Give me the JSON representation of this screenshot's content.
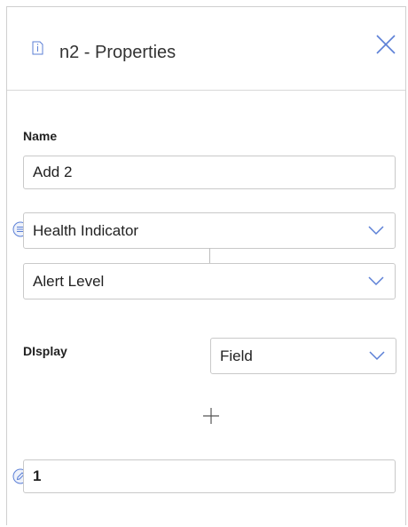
{
  "header": {
    "title": "n2 - Properties"
  },
  "name_section": {
    "label": "Name",
    "value": "Add 2"
  },
  "indicator_select": {
    "value": "Health Indicator"
  },
  "alert_select": {
    "value": "Alert Level"
  },
  "display_section": {
    "label": "DIsplay",
    "value": "Field"
  },
  "value_field": {
    "value": "1"
  },
  "colors": {
    "accent": "#5b7fd6",
    "border": "#c9c9c9",
    "text": "#222222"
  }
}
